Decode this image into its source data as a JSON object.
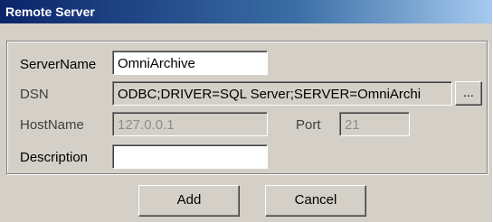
{
  "window": {
    "title": "Remote Server"
  },
  "form": {
    "server_name": {
      "label": "ServerName",
      "value": "OmniArchive"
    },
    "dsn": {
      "label": "DSN",
      "value": "ODBC;DRIVER=SQL Server;SERVER=OmniArchi",
      "browse_label": "..."
    },
    "host_name": {
      "label": "HostName",
      "value": "127.0.0.1"
    },
    "port": {
      "label": "Port",
      "value": "21"
    },
    "description": {
      "label": "Description",
      "value": ""
    }
  },
  "buttons": {
    "add": "Add",
    "cancel": "Cancel"
  }
}
